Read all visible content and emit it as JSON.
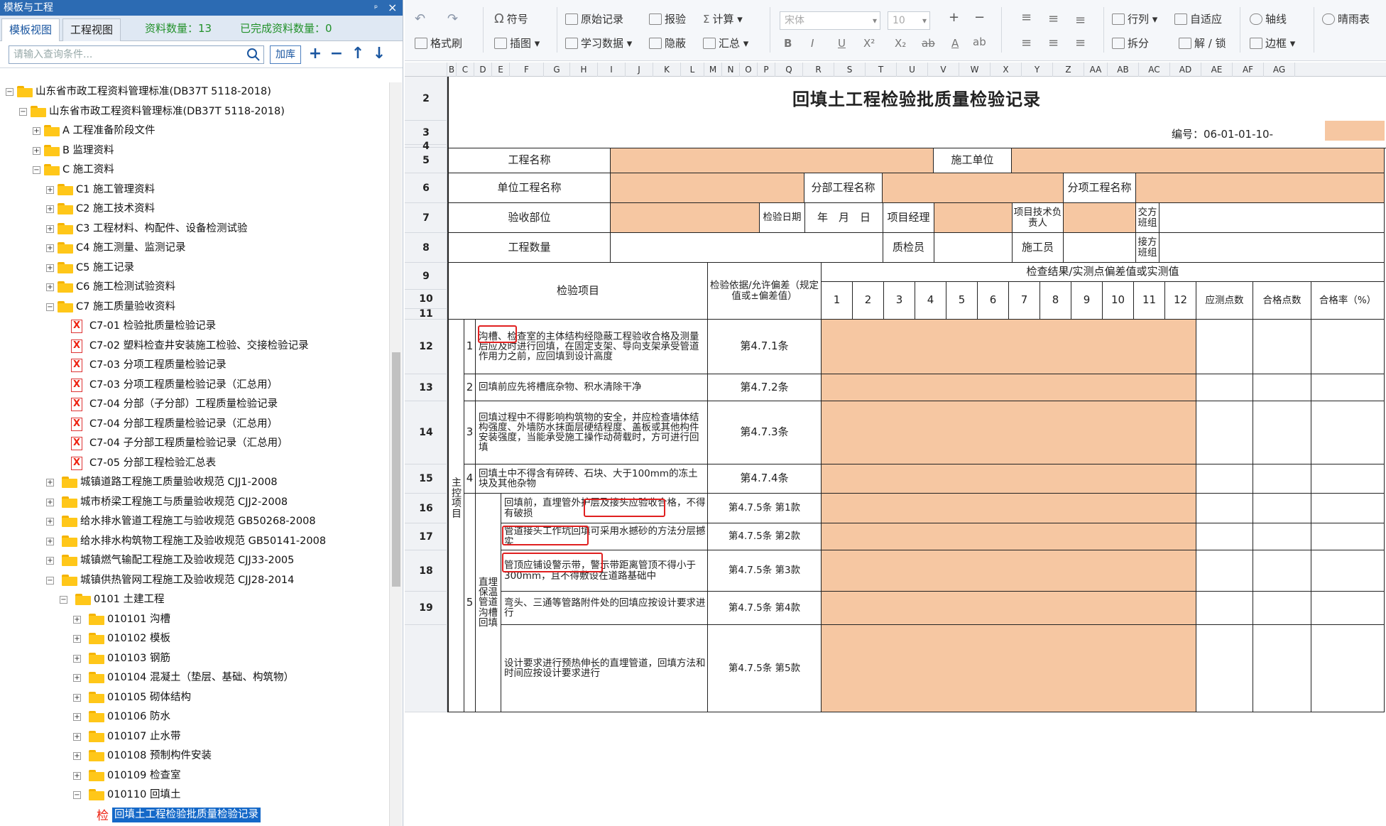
{
  "left_panel": {
    "title": "模板与工程",
    "pin": "ᵖ",
    "close": "×",
    "tabs": [
      "模板视图",
      "工程视图"
    ],
    "count_label": "资料数量：13",
    "done_label": "已完成资料数量：0",
    "search_placeholder": "请输入查询条件...",
    "load_btn": "加库"
  },
  "tree": [
    {
      "d": 0,
      "t": "山东省市政工程资料管理标准(DB37T 5118-2018)",
      "k": "f",
      "o": "-"
    },
    {
      "d": 1,
      "t": "山东省市政工程资料管理标准(DB37T 5118-2018)",
      "k": "f",
      "o": "-"
    },
    {
      "d": 2,
      "t": "A 工程准备阶段文件",
      "k": "f",
      "o": "+"
    },
    {
      "d": 2,
      "t": "B 监理资料",
      "k": "f",
      "o": "+"
    },
    {
      "d": 2,
      "t": "C 施工资料",
      "k": "f",
      "o": "-"
    },
    {
      "d": 3,
      "t": "C1 施工管理资料",
      "k": "f",
      "o": "+"
    },
    {
      "d": 3,
      "t": "C2 施工技术资料",
      "k": "f",
      "o": "+"
    },
    {
      "d": 3,
      "t": "C3 工程材料、构配件、设备检测试验",
      "k": "f",
      "o": "+"
    },
    {
      "d": 3,
      "t": "C4 施工测量、监测记录",
      "k": "f",
      "o": "+"
    },
    {
      "d": 3,
      "t": "C5 施工记录",
      "k": "f",
      "o": "+"
    },
    {
      "d": 3,
      "t": "C6 施工检测试验资料",
      "k": "f",
      "o": "+"
    },
    {
      "d": 3,
      "t": "C7 施工质量验收资料",
      "k": "f",
      "o": "-"
    },
    {
      "d": 4,
      "t": "C7-01 检验批质量检验记录",
      "k": "x"
    },
    {
      "d": 4,
      "t": "C7-02 塑料检查井安装施工检验、交接检验记录",
      "k": "x"
    },
    {
      "d": 4,
      "t": "C7-03 分项工程质量检验记录",
      "k": "x"
    },
    {
      "d": 4,
      "t": "C7-03 分项工程质量检验记录（汇总用）",
      "k": "x"
    },
    {
      "d": 4,
      "t": "C7-04 分部（子分部）工程质量检验记录",
      "k": "x"
    },
    {
      "d": 4,
      "t": "C7-04 分部工程质量检验记录（汇总用）",
      "k": "x"
    },
    {
      "d": 4,
      "t": "C7-04 子分部工程质量检验记录（汇总用）",
      "k": "x"
    },
    {
      "d": 4,
      "t": "C7-05 分部工程检验汇总表",
      "k": "x"
    },
    {
      "d": 3,
      "t": "城镇道路工程施工质量验收规范 CJJ1-2008",
      "k": "f",
      "o": "+",
      "x": true
    },
    {
      "d": 3,
      "t": "城市桥梁工程施工与质量验收规范 CJJ2-2008",
      "k": "f",
      "o": "+",
      "x": true
    },
    {
      "d": 3,
      "t": "给水排水管道工程施工与验收规范 GB50268-2008",
      "k": "f",
      "o": "+",
      "x": true
    },
    {
      "d": 3,
      "t": "给水排水构筑物工程施工及验收规范 GB50141-2008",
      "k": "f",
      "o": "+",
      "x": true
    },
    {
      "d": 3,
      "t": "城镇燃气输配工程施工及验收规范 CJJ33-2005",
      "k": "f",
      "o": "+",
      "x": true
    },
    {
      "d": 3,
      "t": "城镇供热管网工程施工及验收规范 CJJ28-2014",
      "k": "f",
      "o": "-",
      "x": true
    },
    {
      "d": 4,
      "t": "0101 土建工程",
      "k": "f",
      "o": "-",
      "x": true
    },
    {
      "d": 5,
      "t": "010101 沟槽",
      "k": "f",
      "o": "+",
      "x": true
    },
    {
      "d": 5,
      "t": "010102 模板",
      "k": "f",
      "o": "+",
      "x": true
    },
    {
      "d": 5,
      "t": "010103 钢筋",
      "k": "f",
      "o": "+",
      "x": true
    },
    {
      "d": 5,
      "t": "010104 混凝土（垫层、基础、构筑物）",
      "k": "f",
      "o": "+",
      "x": true
    },
    {
      "d": 5,
      "t": "010105 砌体结构",
      "k": "f",
      "o": "+",
      "x": true
    },
    {
      "d": 5,
      "t": "010106 防水",
      "k": "f",
      "o": "+",
      "x": true
    },
    {
      "d": 5,
      "t": "010107 止水带",
      "k": "f",
      "o": "+",
      "x": true
    },
    {
      "d": 5,
      "t": "010108 预制构件安装",
      "k": "f",
      "o": "+",
      "x": true
    },
    {
      "d": 5,
      "t": "010109 检查室",
      "k": "f",
      "o": "+",
      "x": true
    },
    {
      "d": 5,
      "t": "010110 回填土",
      "k": "f",
      "o": "-",
      "x": true
    },
    {
      "d": 6,
      "t": "回填土工程检验批质量检验记录",
      "k": "s",
      "pre": "检"
    }
  ],
  "toolbar": {
    "format_painter": "格式刷",
    "symbol": "符号",
    "insert_image": "插图",
    "original_record": "原始记录",
    "study_data": "学习数据",
    "report": "报验",
    "hide": "隐蔽",
    "calc": "计算",
    "summary": "汇总",
    "font": "宋体",
    "size": "10",
    "row_col": "行列",
    "auto_fit": "自适应",
    "split": "拆分",
    "axis": "轴线",
    "unlock": "解 / 锁",
    "border": "边框",
    "weather": "晴雨表",
    "bold": "B",
    "italic": "I",
    "underline": "U",
    "sup": "X²",
    "sub": "X₂",
    "strike": "ab",
    "fontcolor": "A",
    "ab": "ab"
  },
  "columns": [
    "B",
    "C",
    "D",
    "E",
    "F",
    "G",
    "H",
    "I",
    "J",
    "K",
    "L",
    "M",
    "N",
    "O",
    "P",
    "Q",
    "R",
    "S",
    "T",
    "U",
    "V",
    "W",
    "X",
    "Y",
    "Z",
    "AA",
    "AB",
    "AC",
    "AD",
    "AE",
    "AF",
    "AG"
  ],
  "rows": [
    "2",
    "3",
    "4",
    "5",
    "6",
    "7",
    "8",
    "9",
    "10",
    "11",
    "12",
    "13",
    "14",
    "15",
    "16",
    "17",
    "18",
    "19",
    ""
  ],
  "sheet": {
    "title": "回填土工程检验批质量检验记录",
    "code_label": "编号：06-01-01-10-",
    "r5": {
      "a": "工程名称",
      "b": "施工单位"
    },
    "r6": {
      "a": "单位工程名称",
      "b": "分部工程名称",
      "c": "分项工程名称"
    },
    "r7": {
      "a": "验收部位",
      "b": "检验日期",
      "c": "年　月　日",
      "d": "项目经理",
      "e": "项目技术负责人",
      "f": "交方班组"
    },
    "r8": {
      "a": "工程数量",
      "b": "质检员",
      "c": "施工员",
      "d": "接方班组"
    },
    "hdr": {
      "item": "检验项目",
      "basis": "检验依据/允许偏差（规定值或±偏差值）",
      "result": "检查结果/实测点偏差值或实测值",
      "nums": [
        "1",
        "2",
        "3",
        "4",
        "5",
        "6",
        "7",
        "8",
        "9",
        "10",
        "11",
        "12"
      ],
      "should": "应测点数",
      "pass": "合格点数",
      "rate": "合格率（%）"
    },
    "main_label": "主控项目",
    "items": [
      {
        "n": "1",
        "text": "沟槽、检查室的主体结构经隐蔽工程验收合格及测量后应及时进行回填，在固定支架、导向支架承受管道作用力之前，应回填到设计高度",
        "basis": "第4.7.1条"
      },
      {
        "n": "2",
        "text": "回填前应先将槽底杂物、积水清除干净",
        "basis": "第4.7.2条"
      },
      {
        "n": "3",
        "text": "回填过程中不得影响构筑物的安全，并应检查墙体结构强度、外墙防水抹面层硬结程度、盖板或其他构件安装强度，当能承受施工操作动荷载时，方可进行回填",
        "basis": "第4.7.3条"
      },
      {
        "n": "4",
        "text": "回填土中不得含有碎砖、石块、大于100mm的冻土块及其他杂物",
        "basis": "第4.7.4条"
      }
    ],
    "item5": {
      "n": "5",
      "label": "直埋保温管道沟槽回填",
      "subs": [
        {
          "text": "回填前，直埋管外护层及接头应验收合格，不得有破损",
          "basis": "第4.7.5条 第1款"
        },
        {
          "text": "管道接头工作坑回填可采用水撼砂的方法分层撼实",
          "basis": "第4.7.5条 第2款"
        },
        {
          "text": "管顶应铺设警示带，警示带距离管顶不得小于300mm，且不得敷设在道路基础中",
          "basis": "第4.7.5条 第3款"
        },
        {
          "text": "弯头、三通等管路附件处的回填应按设计要求进行",
          "basis": "第4.7.5条 第4款"
        },
        {
          "text": "设计要求进行预热伸长的直埋管道，回填方法和时间应按设计要求进行",
          "basis": "第4.7.5条 第5款"
        }
      ]
    }
  }
}
